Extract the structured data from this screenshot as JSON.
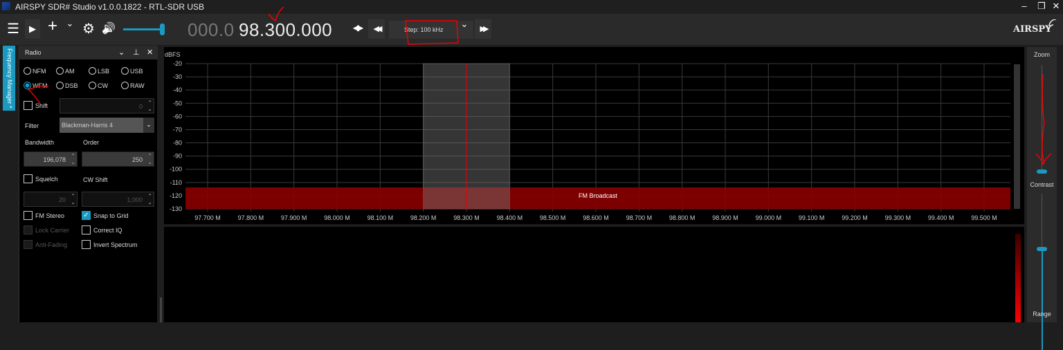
{
  "window": {
    "title": "AIRSPY SDR# Studio v1.0.0.1822 - RTL-SDR USB",
    "minimize": "–",
    "restore": "❐",
    "close": "✕"
  },
  "toolbar": {
    "menu_icon": "☰",
    "play_icon": "▶",
    "add_icon": "+",
    "add_dropdown": "⌄",
    "settings_icon": "⚙",
    "volume_icon": "🔊",
    "volume_level": 0.95,
    "frequency_dim": "000.0",
    "frequency": "98.300.000",
    "tune_mode_icon": "◀▶",
    "step_back_icon": "◀◀",
    "step_label": "Step: 100 kHz",
    "step_dropdown": "⌄",
    "step_forward_icon": "▶▶",
    "logo": "AIRSPY"
  },
  "side_tab": {
    "label": "Frequency Manager *"
  },
  "radio_panel": {
    "title": "Radio",
    "collapse": "⌄",
    "pin": "⊥",
    "close": "✕",
    "modes": [
      {
        "label": "NFM",
        "selected": false
      },
      {
        "label": "AM",
        "selected": false
      },
      {
        "label": "LSB",
        "selected": false
      },
      {
        "label": "USB",
        "selected": false
      },
      {
        "label": "WFM",
        "selected": true
      },
      {
        "label": "DSB",
        "selected": false
      },
      {
        "label": "CW",
        "selected": false
      },
      {
        "label": "RAW",
        "selected": false
      }
    ],
    "shift_label": "Shift",
    "shift_value": "0",
    "filter_label": "Filter",
    "filter_value": "Blackman-Harris 4",
    "bandwidth_label": "Bandwidth",
    "bandwidth_value": "196,078",
    "order_label": "Order",
    "order_value": "250",
    "squelch_label": "Squelch",
    "squelch_value": "20",
    "cw_shift_label": "CW Shift",
    "cw_shift_value": "1,000",
    "fm_stereo": "FM Stereo",
    "snap_to_grid": "Snap to Grid",
    "lock_carrier": "Lock Carrier",
    "correct_iq": "Correct IQ",
    "anti_fading": "Anti-Fading",
    "invert_spectrum": "Invert Spectrum"
  },
  "spectrum": {
    "unit": "dBFS",
    "y_ticks": [
      "-20",
      "-30",
      "-40",
      "-50",
      "-60",
      "-70",
      "-80",
      "-90",
      "-100",
      "-110",
      "-120",
      "-130"
    ],
    "x_ticks": [
      "97.700 M",
      "97.800 M",
      "97.900 M",
      "98.000 M",
      "98.100 M",
      "98.200 M",
      "98.300 M",
      "98.400 M",
      "98.500 M",
      "98.600 M",
      "98.700 M",
      "98.800 M",
      "98.900 M",
      "99.000 M",
      "99.100 M",
      "99.200 M",
      "99.300 M",
      "99.400 M",
      "99.500 M"
    ],
    "center_mhz": 98.3,
    "bandwidth_mhz": 0.2,
    "band_label": "FM Broadcast",
    "band_color": "#8b0000",
    "accent": "#1a9ac0"
  },
  "right_panel": {
    "zoom_label": "Zoom",
    "contrast_label": "Contrast",
    "range_label": "Range"
  }
}
